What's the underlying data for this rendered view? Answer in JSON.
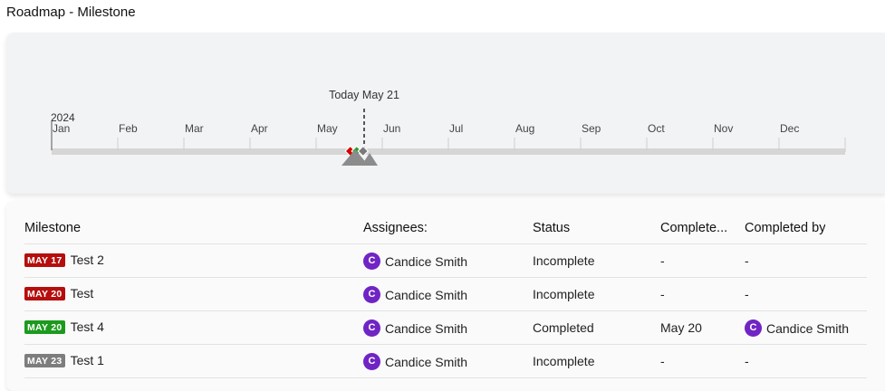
{
  "page_title": "Roadmap - Milestone",
  "timeline": {
    "year_label": "2024",
    "today_label": "Today May 21",
    "months": [
      "Jan",
      "Feb",
      "Mar",
      "Apr",
      "May",
      "Jun",
      "Jul",
      "Aug",
      "Sep",
      "Oct",
      "Nov",
      "Dec"
    ],
    "markers": [
      {
        "date": "May 17",
        "color": "#d40000"
      },
      {
        "date": "May 20",
        "color": "#2a9d2a"
      },
      {
        "date": "May 23",
        "color": "#7a7a7a"
      }
    ]
  },
  "table": {
    "headers": {
      "milestone": "Milestone",
      "assignees": "Assignees:",
      "status": "Status",
      "completed_on": "Complete...",
      "completed_by": "Completed by"
    },
    "rows": [
      {
        "badge": "MAY 17",
        "badge_color": "#b50e0e",
        "name": "Test 2",
        "assignee_initial": "C",
        "assignee": "Candice Smith",
        "status": "Incomplete",
        "completed_on": "-",
        "completed_by_initial": "",
        "completed_by": "-"
      },
      {
        "badge": "MAY 20",
        "badge_color": "#b50e0e",
        "name": "Test",
        "assignee_initial": "C",
        "assignee": "Candice Smith",
        "status": "Incomplete",
        "completed_on": "-",
        "completed_by_initial": "",
        "completed_by": "-"
      },
      {
        "badge": "MAY 20",
        "badge_color": "#1d9a1d",
        "name": "Test 4",
        "assignee_initial": "C",
        "assignee": "Candice Smith",
        "status": "Completed",
        "completed_on": "May 20",
        "completed_by_initial": "C",
        "completed_by": "Candice Smith"
      },
      {
        "badge": "MAY 23",
        "badge_color": "#7d7d7d",
        "name": "Test 1",
        "assignee_initial": "C",
        "assignee": "Candice Smith",
        "status": "Incomplete",
        "completed_on": "-",
        "completed_by_initial": "",
        "completed_by": "-"
      }
    ]
  }
}
